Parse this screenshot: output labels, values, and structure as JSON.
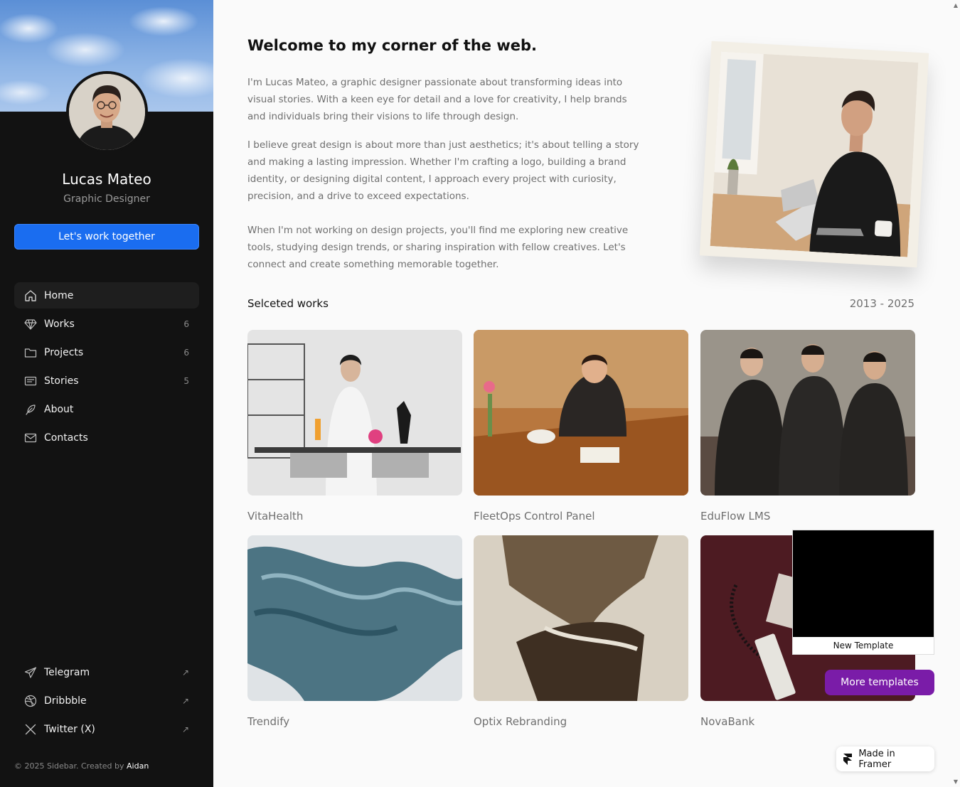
{
  "sidebar": {
    "profile": {
      "name": "Lucas Mateo",
      "role": "Graphic Designer"
    },
    "cta_label": "Let's work together",
    "nav": [
      {
        "label": "Home",
        "icon": "home-icon",
        "count": ""
      },
      {
        "label": "Works",
        "icon": "diamond-icon",
        "count": "6"
      },
      {
        "label": "Projects",
        "icon": "folder-icon",
        "count": "6"
      },
      {
        "label": "Stories",
        "icon": "newspaper-icon",
        "count": "5"
      },
      {
        "label": "About",
        "icon": "feather-icon",
        "count": ""
      },
      {
        "label": "Contacts",
        "icon": "mail-icon",
        "count": ""
      }
    ],
    "social": [
      {
        "label": "Telegram",
        "icon": "telegram-icon",
        "arrow": "↗"
      },
      {
        "label": "Dribbble",
        "icon": "dribbble-icon",
        "arrow": "↗"
      },
      {
        "label": "Twitter (X)",
        "icon": "x-icon",
        "arrow": "↗"
      }
    ],
    "footer": {
      "text": "© 2025 Sidebar. Created by ",
      "author": "Aidan"
    }
  },
  "main": {
    "headline": "Welcome to my corner of the web.",
    "paragraphs": [
      "I'm Lucas Mateo, a graphic designer passionate about  transforming ideas into visual stories. With a keen eye for detail and a love for creativity, I help brands and individuals bring their visions to life through design.",
      "I believe great design is about more than just aesthetics; it's about telling a story and making a lasting impression. Whether I'm crafting a logo, building a brand identity, or designing digital content, I approach every project with curiosity, precision, and a drive to exceed expectations.",
      "When I'm not working on design projects, you'll find me exploring new creative tools, studying design trends, or sharing inspiration with fellow creatives. Let's connect and create something memorable together."
    ],
    "works_title": "Selceted works",
    "works_range": "2013 - 2025",
    "works": [
      {
        "title": "VitaHealth"
      },
      {
        "title": "FleetOps Control Panel"
      },
      {
        "title": "EduFlow LMS"
      },
      {
        "title": "Trendify"
      },
      {
        "title": "Optix Rebranding"
      },
      {
        "title": "NovaBank"
      }
    ]
  },
  "widgets": {
    "template_caption": "New Template",
    "more_templates": "More templates",
    "framer_badge": "Made in Framer"
  },
  "colors": {
    "accent_blue": "#1a6df0",
    "sidebar_bg": "#121212",
    "more_templates_bg": "#7a1ca8"
  }
}
